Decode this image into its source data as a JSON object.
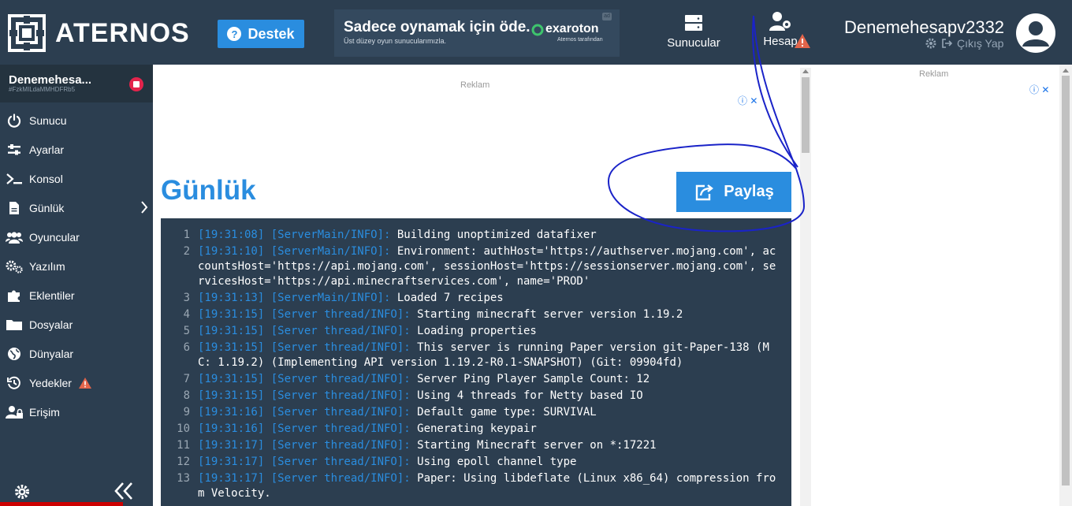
{
  "topbar": {
    "logo_text": "ATERNOS",
    "support_label": "Destek",
    "promo": {
      "title": "Sadece oynamak için öde.",
      "subtitle": "Üst düzey oyun sunucularımızla.",
      "brand": "exaroton",
      "brand_sub": "Aternos tarafından"
    },
    "nav": {
      "servers_label": "Sunucular",
      "account_label": "Hesap"
    },
    "user": {
      "name": "Denemehesapv2332",
      "logout_label": "Çıkış Yap"
    }
  },
  "sidebar": {
    "server_name": "Denemehesa...",
    "server_id": "#FzkMILdaMMHDFRb5",
    "items": [
      {
        "label": "Sunucu",
        "icon": "power-icon"
      },
      {
        "label": "Ayarlar",
        "icon": "sliders-icon"
      },
      {
        "label": "Konsol",
        "icon": "terminal-icon"
      },
      {
        "label": "Günlük",
        "icon": "file-icon"
      },
      {
        "label": "Oyuncular",
        "icon": "users-icon"
      },
      {
        "label": "Yazılım",
        "icon": "gears-icon"
      },
      {
        "label": "Eklentiler",
        "icon": "puzzle-icon"
      },
      {
        "label": "Dosyalar",
        "icon": "folder-icon"
      },
      {
        "label": "Dünyalar",
        "icon": "globe-icon"
      },
      {
        "label": "Yedekler",
        "icon": "history-icon"
      },
      {
        "label": "Erişim",
        "icon": "user-lock-icon"
      }
    ]
  },
  "main": {
    "ad_label": "Reklam",
    "right_ad_label": "Reklam",
    "title": "Günlük",
    "share_label": "Paylaş",
    "log": [
      {
        "n": "1",
        "tag": "[19:31:08] [ServerMain/INFO]:",
        "msg": " Building unoptimized datafixer"
      },
      {
        "n": "2",
        "tag": "[19:31:10] [ServerMain/INFO]:",
        "msg": " Environment: authHost='https://authserver.mojang.com', accountsHost='https://api.mojang.com', sessionHost='https://sessionserver.mojang.com', servicesHost='https://api.minecraftservices.com', name='PROD'"
      },
      {
        "n": "3",
        "tag": "[19:31:13] [ServerMain/INFO]:",
        "msg": " Loaded 7 recipes"
      },
      {
        "n": "4",
        "tag": "[19:31:15] [Server thread/INFO]:",
        "msg": " Starting minecraft server version 1.19.2"
      },
      {
        "n": "5",
        "tag": "[19:31:15] [Server thread/INFO]:",
        "msg": " Loading properties"
      },
      {
        "n": "6",
        "tag": "[19:31:15] [Server thread/INFO]:",
        "msg": " This server is running Paper version git-Paper-138 (MC: 1.19.2) (Implementing API version 1.19.2-R0.1-SNAPSHOT) (Git: 09904fd)"
      },
      {
        "n": "7",
        "tag": "[19:31:15] [Server thread/INFO]:",
        "msg": " Server Ping Player Sample Count: 12"
      },
      {
        "n": "8",
        "tag": "[19:31:15] [Server thread/INFO]:",
        "msg": " Using 4 threads for Netty based IO"
      },
      {
        "n": "9",
        "tag": "[19:31:16] [Server thread/INFO]:",
        "msg": " Default game type: SURVIVAL"
      },
      {
        "n": "10",
        "tag": "[19:31:16] [Server thread/INFO]:",
        "msg": " Generating keypair"
      },
      {
        "n": "11",
        "tag": "[19:31:17] [Server thread/INFO]:",
        "msg": " Starting Minecraft server on *:17221"
      },
      {
        "n": "12",
        "tag": "[19:31:17] [Server thread/INFO]:",
        "msg": " Using epoll channel type"
      },
      {
        "n": "13",
        "tag": "[19:31:17] [Server thread/INFO]:",
        "msg": " Paper: Using libdeflate (Linux x86_64) compression from Velocity."
      }
    ]
  },
  "colors": {
    "dark": "#2c3e50",
    "accent": "#2a8ddf",
    "warning": "#e2654b",
    "annotation": "#1a23c8"
  }
}
